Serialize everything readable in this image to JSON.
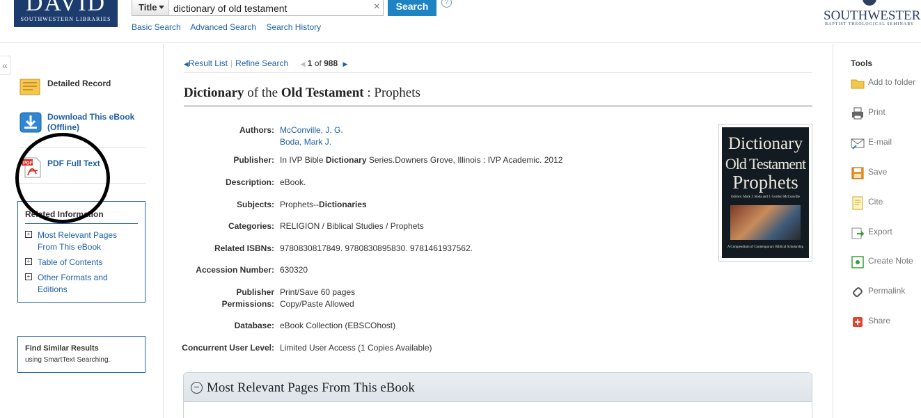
{
  "header": {
    "logo_text": "DAVID",
    "logo_sub": "SOUTHWESTERN LIBRARIES",
    "field_select": "Title",
    "search_value": "dictionary of old testament",
    "search_button": "Search",
    "help": "?",
    "links": [
      "Basic Search",
      "Advanced Search",
      "Search History"
    ],
    "brand_name": "SOUTHWESTERN",
    "brand_sub": "BAPTIST THEOLOGICAL SEMINARY"
  },
  "sidebar": {
    "collapse": "«",
    "detailed_record": "Detailed Record",
    "download_ebook": "Download This eBook (Offline)",
    "pdf_full_text": "PDF Full Text",
    "related": {
      "title": "Related Information",
      "items": [
        "Most Relevant Pages From This eBook",
        "Table of Contents",
        "Other Formats and Editions"
      ]
    },
    "similar": {
      "title": "Find Similar Results",
      "subtitle": "using SmartText Searching."
    }
  },
  "nav": {
    "result_list": "Result List",
    "refine_search": "Refine Search",
    "position": "1",
    "of_text": "of",
    "total": "988"
  },
  "record": {
    "title_parts": [
      {
        "text": "Dictionary",
        "bold": true
      },
      {
        "text": " of the ",
        "bold": false
      },
      {
        "text": "Old Testament",
        "bold": true
      },
      {
        "text": " : Prophets",
        "bold": false
      }
    ],
    "fields": {
      "authors_label": "Authors:",
      "authors": [
        "McConville, J. G.",
        "Boda, Mark J."
      ],
      "publisher_label": "Publisher:",
      "publisher_pre": "In IVP Bible ",
      "publisher_bold": "Dictionary",
      "publisher_post": " Series.Downers Grove, Illinois : IVP Academic. 2012",
      "description_label": "Description:",
      "description": "eBook.",
      "subjects_label": "Subjects:",
      "subjects_pre": "Prophets--",
      "subjects_bold": "Dictionaries",
      "categories_label": "Categories:",
      "categories": "RELIGION / Biblical Studies / Prophets",
      "isbns_label": "Related ISBNs:",
      "isbns": "9780830817849. 9780830895830. 9781461937562.",
      "accession_label": "Accession Number:",
      "accession": "630320",
      "permissions_label_1": "Publisher",
      "permissions_label_2": "Permissions:",
      "permissions_1": "Print/Save 60 pages",
      "permissions_2": "Copy/Paste Allowed",
      "database_label": "Database:",
      "database": "eBook Collection (EBSCOhost)",
      "concurrent_label": "Concurrent User Level:",
      "concurrent": "Limited User Access (1 Copies Available)"
    },
    "cover": {
      "line1": "Dictionary",
      "line2": "Old Testament",
      "line3": "Prophets",
      "editors": "Editors: Mark J. Boda and J. Gordon McConville",
      "series": "A Compendium of Contemporary Biblical Scholarship"
    }
  },
  "panel": {
    "toggle": "−",
    "title": "Most Relevant Pages From This eBook"
  },
  "tools": {
    "title": "Tools",
    "items": [
      "Add to folder",
      "Print",
      "E-mail",
      "Save",
      "Cite",
      "Export",
      "Create Note",
      "Permalink",
      "Share"
    ]
  }
}
